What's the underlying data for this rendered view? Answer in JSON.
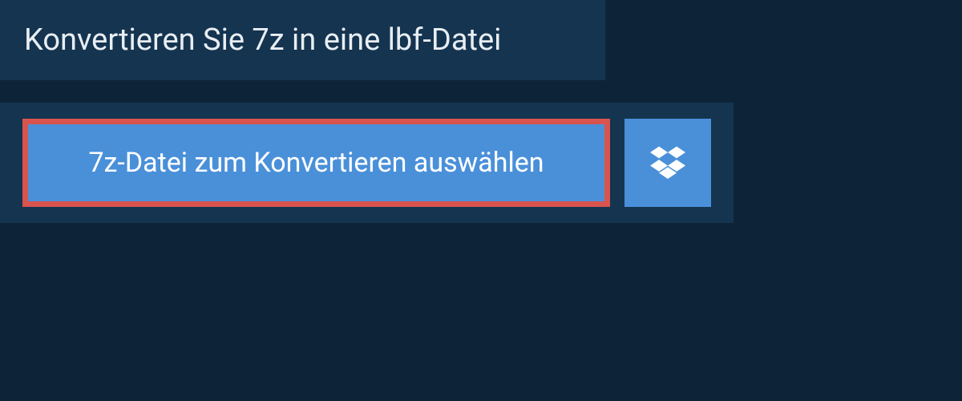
{
  "title": "Konvertieren Sie 7z in eine lbf-Datei",
  "actions": {
    "select_file_label": "7z-Datei zum Konvertieren auswählen"
  },
  "colors": {
    "background": "#0d2438",
    "panel": "#153450",
    "button": "#4a90d9",
    "highlight_border": "#d9534f",
    "text_light": "#e8eef3",
    "text_white": "#ffffff"
  }
}
